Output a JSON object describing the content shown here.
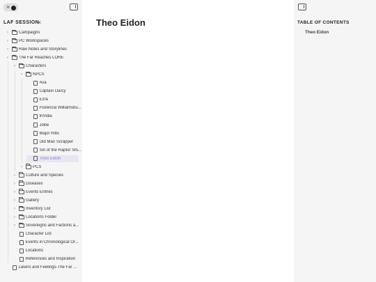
{
  "sidebar": {
    "site_title": "LAF SESSION",
    "toggle_icons": {
      "light": "sun-icon",
      "dark": "moon-icon"
    },
    "tree": [
      {
        "label": "Campaigns",
        "type": "folder",
        "depth": 0,
        "expanded": false
      },
      {
        "label": "PC Workspaces",
        "type": "folder",
        "depth": 0,
        "expanded": false
      },
      {
        "label": "Raw Notes and Storylines",
        "type": "folder",
        "depth": 0,
        "expanded": false
      },
      {
        "label": "The Far Reaches LORE",
        "type": "folder",
        "depth": 0,
        "expanded": true
      },
      {
        "label": "Characters",
        "type": "folder",
        "depth": 1,
        "expanded": true
      },
      {
        "label": "NPCS",
        "type": "folder",
        "depth": 2,
        "expanded": true
      },
      {
        "label": "Ava",
        "type": "file",
        "depth": 3
      },
      {
        "label": "Captain Darcy",
        "type": "file",
        "depth": 3
      },
      {
        "label": "Ezra",
        "type": "file",
        "depth": 3
      },
      {
        "label": "Florencia Williamsbu...",
        "type": "file",
        "depth": 3
      },
      {
        "label": "InVidia",
        "type": "file",
        "depth": 3
      },
      {
        "label": "Jollie",
        "type": "file",
        "depth": 3
      },
      {
        "label": "Major Ribs",
        "type": "file",
        "depth": 3
      },
      {
        "label": "Old Man Scrapper",
        "type": "file",
        "depth": 3
      },
      {
        "label": "Siri of the Raptor Shi...",
        "type": "file",
        "depth": 3
      },
      {
        "label": "Theo Eidon",
        "type": "file",
        "depth": 3,
        "active": true
      },
      {
        "label": "PCS",
        "type": "folder",
        "depth": 2,
        "expanded": false
      },
      {
        "label": "Culture and Species",
        "type": "folder",
        "depth": 1,
        "expanded": false
      },
      {
        "label": "Diseases",
        "type": "folder",
        "depth": 1,
        "expanded": false
      },
      {
        "label": "Events Entries",
        "type": "folder",
        "depth": 1,
        "expanded": false
      },
      {
        "label": "Gallery",
        "type": "folder",
        "depth": 1,
        "expanded": false
      },
      {
        "label": "Inventory List",
        "type": "folder",
        "depth": 1,
        "expanded": false
      },
      {
        "label": "Locations Folder",
        "type": "folder",
        "depth": 1,
        "expanded": false
      },
      {
        "label": "Sovereigns and Factions a...",
        "type": "folder",
        "depth": 1,
        "expanded": false
      },
      {
        "label": "Character List",
        "type": "file",
        "depth": 1
      },
      {
        "label": "Events in Chronological Or...",
        "type": "file",
        "depth": 1
      },
      {
        "label": "Locations",
        "type": "file",
        "depth": 1
      },
      {
        "label": "References and Inspiration",
        "type": "file",
        "depth": 1
      },
      {
        "label": "Lasers and Feelings-The Far ...",
        "type": "file",
        "depth": 0
      }
    ]
  },
  "main": {
    "page_title": "Theo Eidon"
  },
  "toc": {
    "title": "TABLE OF CONTENTS",
    "items": [
      "Theo Eidon"
    ]
  },
  "colors": {
    "sidebar_bg": "#f5f5f5",
    "active_text": "#8a7fd6",
    "active_bg": "#e8e6f3"
  }
}
